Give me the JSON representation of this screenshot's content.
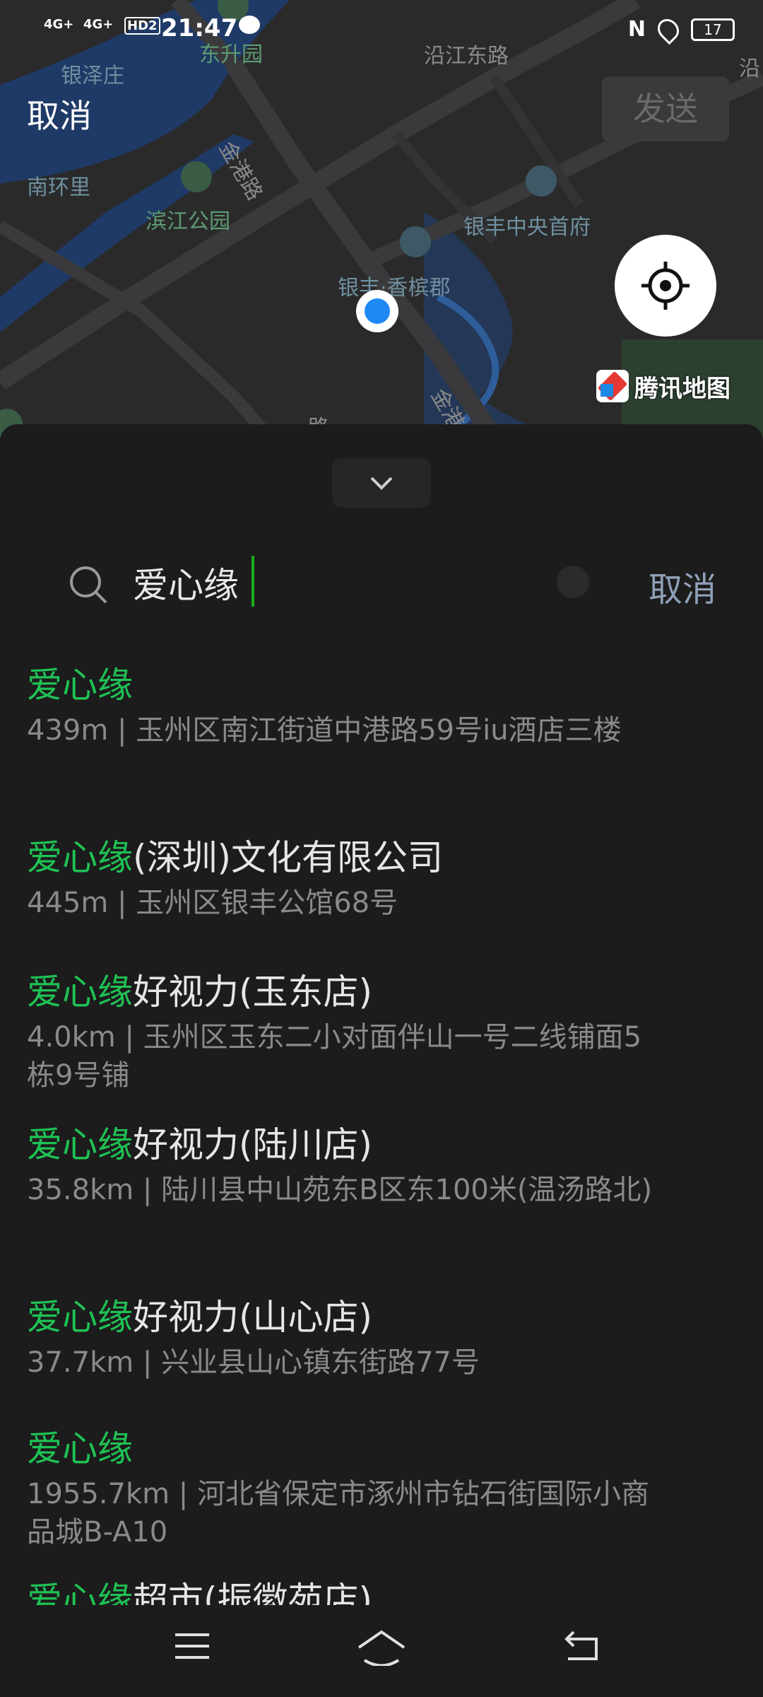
{
  "status_bar": {
    "time": "21:47",
    "signal1": "4G+",
    "signal2": "4G+",
    "hd": "HD2",
    "battery": "17"
  },
  "header": {
    "cancel_label": "取消",
    "send_label": "发送"
  },
  "map": {
    "labels": [
      "沿江东路",
      "银泽庄",
      "东升园",
      "南环里",
      "金港路",
      "滨江公园",
      "银丰中央首府",
      "银丰·香槟郡",
      "金港路",
      "路",
      "沿"
    ],
    "provider": "腾讯地图"
  },
  "search": {
    "query": "爱心缘",
    "cancel_label": "取消"
  },
  "results": [
    {
      "highlight": "爱心缘",
      "rest": "",
      "address": "439m | 玉州区南江街道中港路59号iu酒店三楼"
    },
    {
      "highlight": "爱心缘",
      "rest": "(深圳)文化有限公司",
      "address": "445m | 玉州区银丰公馆68号"
    },
    {
      "highlight": "爱心缘",
      "rest": "好视力(玉东店)",
      "address": "4.0km | 玉州区玉东二小对面伴山一号二线铺面5栋9号铺"
    },
    {
      "highlight": "爱心缘",
      "rest": "好视力(陆川店)",
      "address": "35.8km | 陆川县中山苑东B区东100米(温汤路北)"
    },
    {
      "highlight": "爱心缘",
      "rest": "好视力(山心店)",
      "address": "37.7km | 兴业县山心镇东街路77号"
    },
    {
      "highlight": "爱心缘",
      "rest": "",
      "address": "1955.7km | 河北省保定市涿州市钻石街国际小商品城B-A10"
    },
    {
      "highlight": "爱心缘",
      "rest": "超市(振徽苑店)",
      "address": ""
    }
  ],
  "colors": {
    "highlight": "#1fc254",
    "accent_link": "#8ea0b8",
    "user_dot": "#1e88f5"
  }
}
